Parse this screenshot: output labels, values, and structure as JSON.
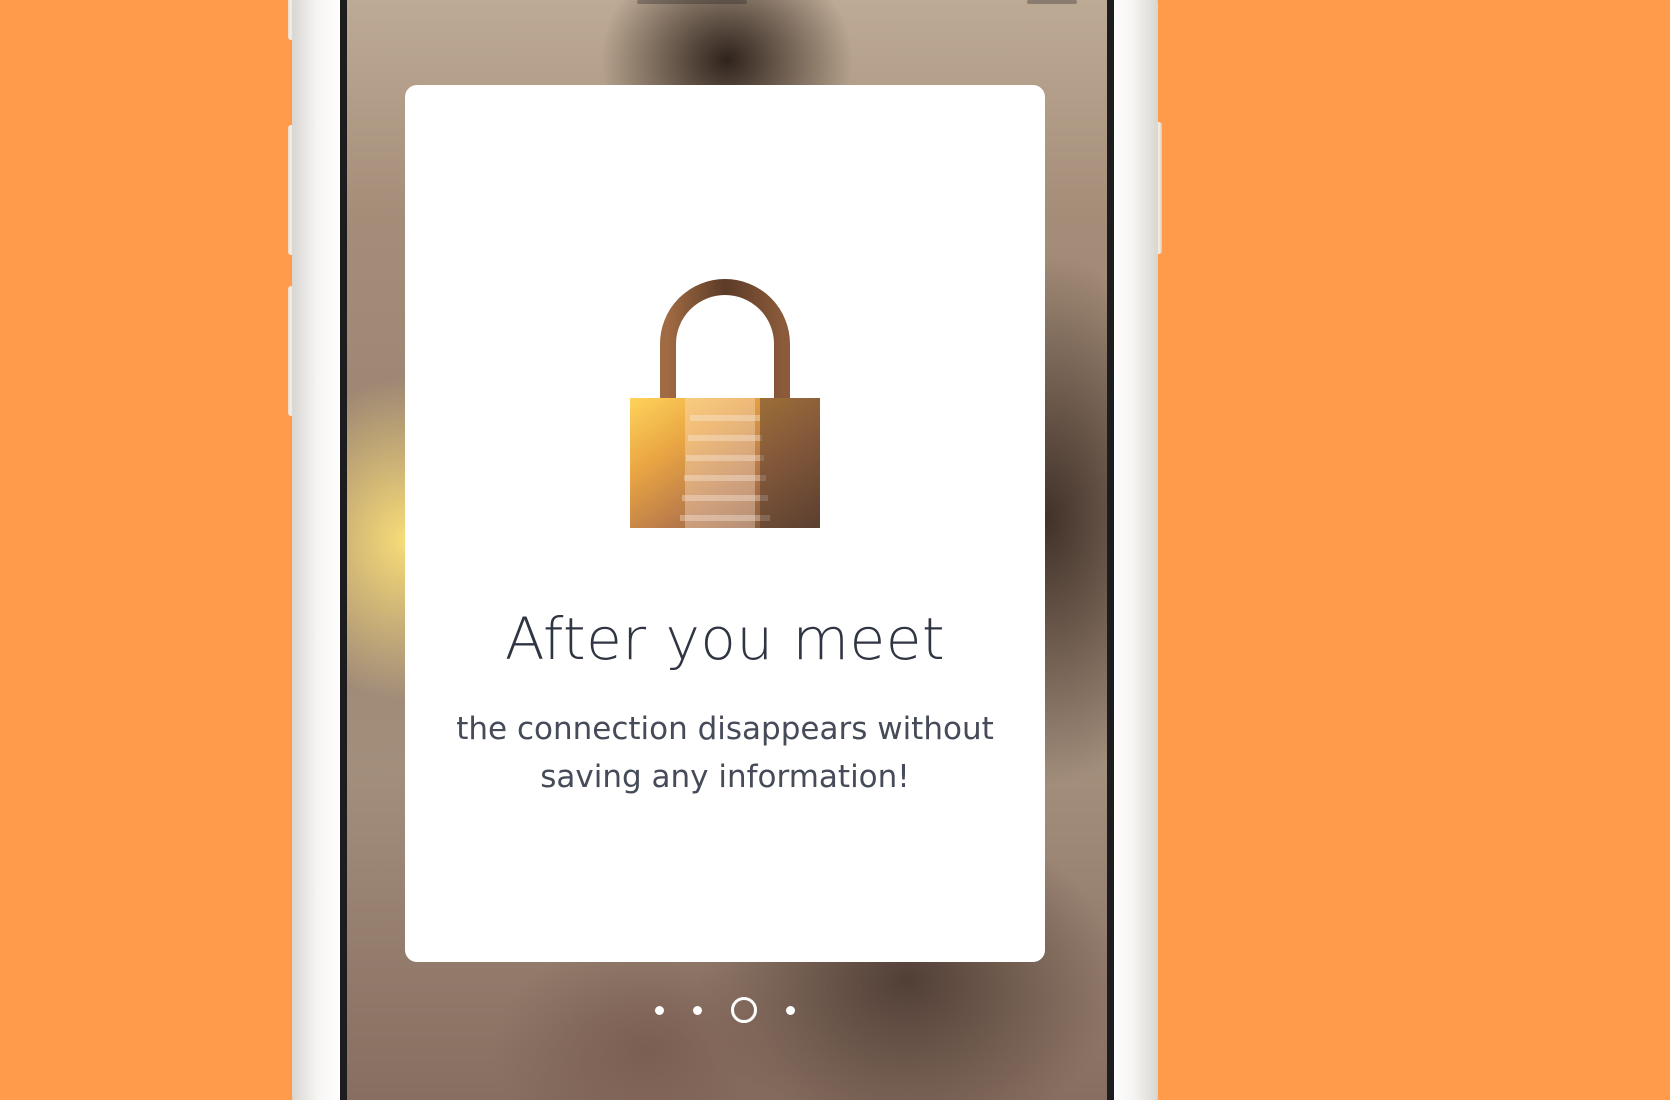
{
  "colors": {
    "background": "#FF9B4A",
    "card": "#FFFFFF",
    "title_text": "#2F3542",
    "body_text": "#454B58",
    "dot": "#FFFFFF"
  },
  "onboarding": {
    "icon": "lock-icon",
    "title": "After you meet",
    "subtitle": "the connection disappears without saving any information!",
    "pagination": {
      "total_pages": 4,
      "current_page": 3
    }
  }
}
